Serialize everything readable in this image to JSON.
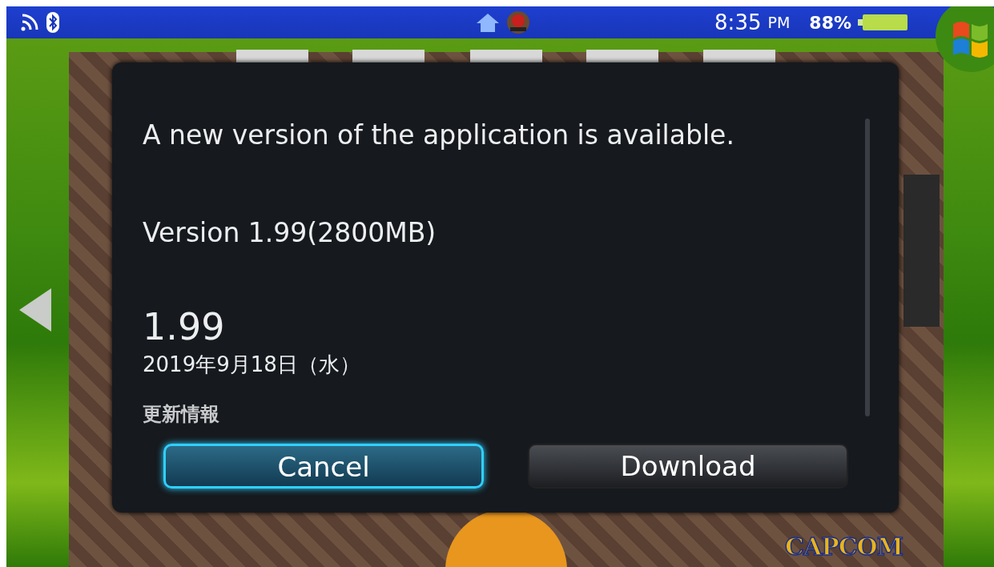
{
  "status_bar": {
    "time": "8:35",
    "meridiem": "PM",
    "battery": "88%"
  },
  "live_area": {
    "brand": "CAPCOM"
  },
  "dialog": {
    "message": "A new version of the application is available.",
    "version_line": "Version 1.99(2800MB)",
    "version": "1.99",
    "date": "2019年9月18日（水）",
    "section_heading": "更新情報",
    "buttons": [
      {
        "label": "Cancel",
        "selected": true
      },
      {
        "label": "Download",
        "selected": false
      }
    ]
  }
}
